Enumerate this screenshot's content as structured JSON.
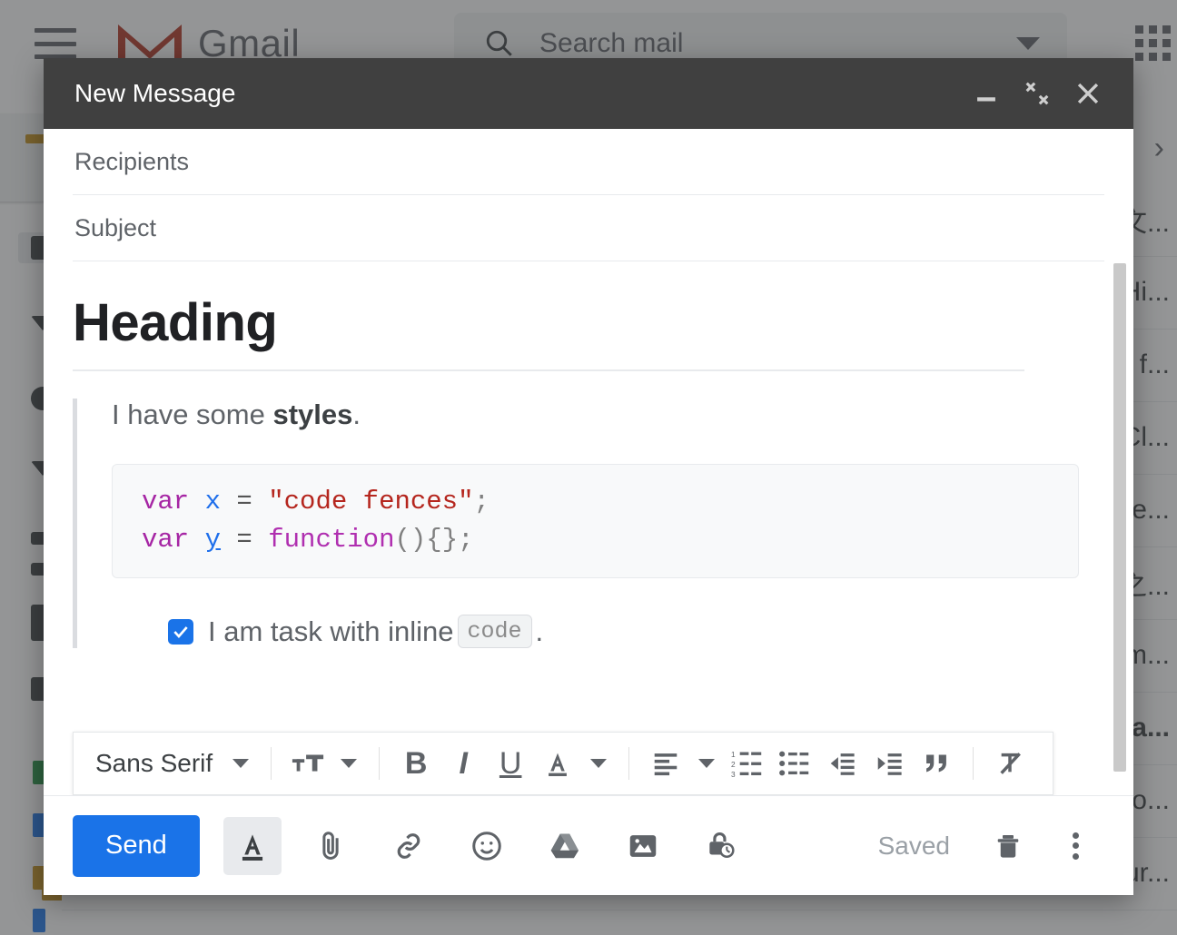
{
  "background": {
    "brand": "Gmail",
    "menu_icon": "hamburger-icon",
    "search": {
      "placeholder": "Search mail",
      "icon": "search-icon",
      "options_icon": "chevron-down-icon"
    },
    "apps_icon": "apps-grid-icon",
    "list_expand_icon": "chevron-right-icon",
    "mail_rows": [
      {
        "snippet": "文...",
        "bold": false
      },
      {
        "snippet": "Hi...",
        "bold": false
      },
      {
        "snippet": "n f...",
        "bold": false
      },
      {
        "snippet": "Cl...",
        "bold": false
      },
      {
        "snippet": "te...",
        "bold": false
      },
      {
        "snippet": "之...",
        "bold": false
      },
      {
        "snippet": "m...",
        "bold": false
      },
      {
        "snippet": "la...",
        "bold": true
      },
      {
        "snippet": "o...",
        "bold": false
      },
      {
        "snippet": "ur...",
        "bold": false
      }
    ],
    "label_colors": [
      "#1e8e3e",
      "#1a73e8",
      "#c5901a",
      "#1a73e8",
      "#c5901a"
    ]
  },
  "compose": {
    "title": "New Message",
    "header_buttons": {
      "minimize": "minimize-icon",
      "restore": "exit-full-screen-icon",
      "close": "close-icon"
    },
    "fields": {
      "recipients_placeholder": "Recipients",
      "recipients_value": "",
      "subject_placeholder": "Subject",
      "subject_value": ""
    },
    "body": {
      "heading": "Heading",
      "quote_text_plain": "I have some ",
      "quote_text_bold": "styles",
      "quote_text_tail": ".",
      "code_lines": [
        [
          {
            "t": "var",
            "c": "kw"
          },
          {
            "t": " ",
            "c": "op"
          },
          {
            "t": "x",
            "c": "var"
          },
          {
            "t": " = ",
            "c": "op"
          },
          {
            "t": "\"code fences\"",
            "c": "str"
          },
          {
            "t": ";",
            "c": "pun"
          }
        ],
        [
          {
            "t": "var",
            "c": "kw"
          },
          {
            "t": " ",
            "c": "op"
          },
          {
            "t": "y",
            "c": "varu"
          },
          {
            "t": " = ",
            "c": "op"
          },
          {
            "t": "function",
            "c": "fn"
          },
          {
            "t": "(){};",
            "c": "pun"
          }
        ]
      ],
      "task_checked": true,
      "task_text_before": "I am task with inline ",
      "task_inline_code": "code",
      "task_text_after": "."
    },
    "format_toolbar": {
      "font_family": "Sans Serif",
      "buttons": [
        {
          "name": "font-size-button",
          "icon": "font-size-icon"
        },
        {
          "name": "bold-button",
          "icon": "bold-icon",
          "glyph": "B"
        },
        {
          "name": "italic-button",
          "icon": "italic-icon",
          "glyph": "I"
        },
        {
          "name": "underline-button",
          "icon": "underline-icon",
          "glyph": "U"
        },
        {
          "name": "text-color-button",
          "icon": "text-color-icon"
        },
        {
          "name": "align-button",
          "icon": "align-left-icon"
        },
        {
          "name": "numbered-list-button",
          "icon": "numbered-list-icon"
        },
        {
          "name": "bulleted-list-button",
          "icon": "bulleted-list-icon"
        },
        {
          "name": "decrease-indent-button",
          "icon": "decrease-indent-icon"
        },
        {
          "name": "increase-indent-button",
          "icon": "increase-indent-icon"
        },
        {
          "name": "quote-button",
          "icon": "quote-icon"
        },
        {
          "name": "remove-formatting-button",
          "icon": "remove-formatting-icon"
        }
      ]
    },
    "actions": {
      "send_label": "Send",
      "formatting_icon": "formatting-options-icon",
      "attach_icon": "attach-file-icon",
      "link_icon": "insert-link-icon",
      "emoji_icon": "insert-emoji-icon",
      "drive_icon": "google-drive-icon",
      "photo_icon": "insert-photo-icon",
      "confidential_icon": "confidential-mode-icon",
      "saved_status": "Saved",
      "discard_icon": "trash-icon",
      "more_icon": "more-options-icon"
    }
  },
  "colors": {
    "accent": "#1a73e8",
    "header_bg": "#404040",
    "muted_text": "#5f6368"
  }
}
